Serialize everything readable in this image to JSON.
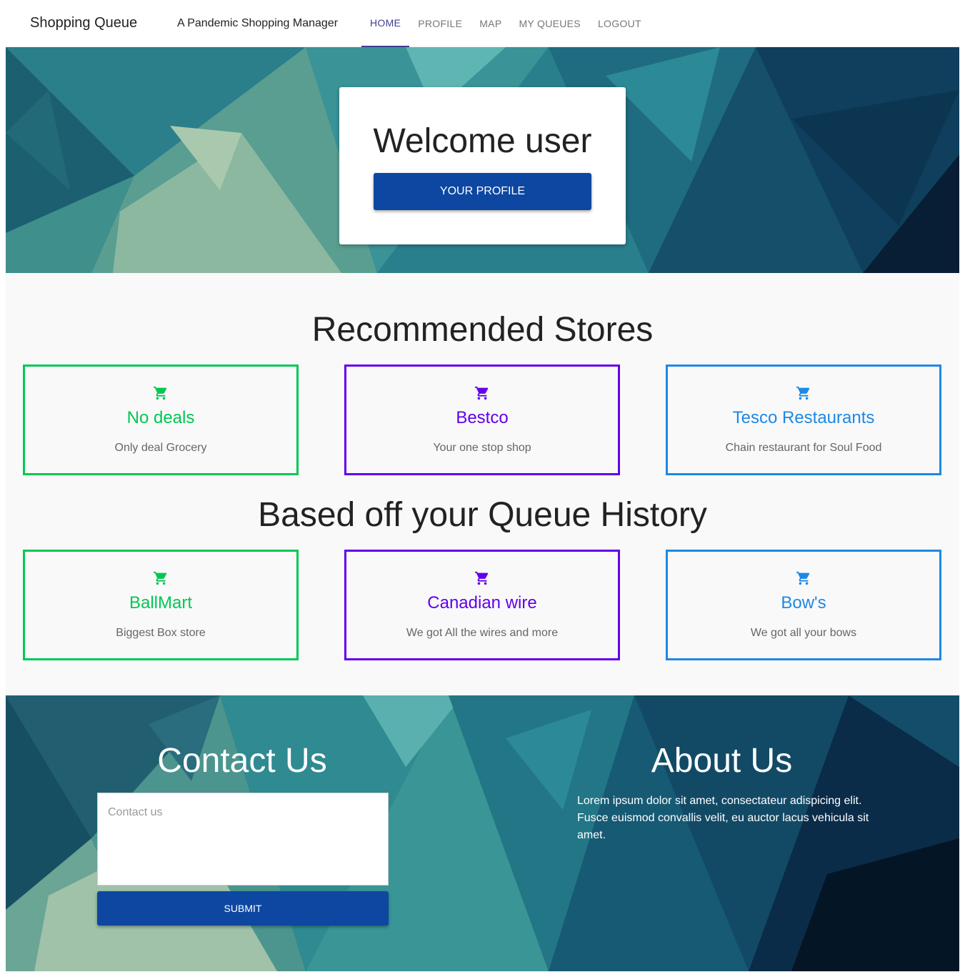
{
  "header": {
    "brand": "Shopping Queue",
    "tagline": "A Pandemic Shopping Manager",
    "nav": [
      {
        "label": "HOME",
        "active": true
      },
      {
        "label": "PROFILE",
        "active": false
      },
      {
        "label": "MAP",
        "active": false
      },
      {
        "label": "MY QUEUES",
        "active": false
      },
      {
        "label": "LOGOUT",
        "active": false
      }
    ]
  },
  "hero": {
    "welcome": "Welcome user",
    "profile_button": "YOUR PROFILE"
  },
  "recommended": {
    "title": "Recommended Stores",
    "stores": [
      {
        "name": "No deals",
        "desc": "Only deal Grocery",
        "color": "#00c853"
      },
      {
        "name": "Bestco",
        "desc": "Your one stop shop",
        "color": "#6200ea"
      },
      {
        "name": "Tesco Restaurants",
        "desc": "Chain restaurant for Soul Food",
        "color": "#1e88e5"
      }
    ]
  },
  "history": {
    "title": "Based off your Queue History",
    "stores": [
      {
        "name": "BallMart",
        "desc": "Biggest Box store",
        "color": "#00c853"
      },
      {
        "name": "Canadian wire",
        "desc": "We got All the wires and more",
        "color": "#6200ea"
      },
      {
        "name": "Bow's",
        "desc": "We got all your bows",
        "color": "#1e88e5"
      }
    ]
  },
  "contact": {
    "title": "Contact Us",
    "placeholder": "Contact us",
    "submit": "SUBMIT"
  },
  "about": {
    "title": "About Us",
    "text": "Lorem ipsum dolor sit amet, consectateur adispicing elit. Fusce euismod convallis velit, eu auctor lacus vehicula sit amet."
  },
  "icons": {
    "store": "shopping-cart-icon"
  },
  "colors": {
    "primary_button": "#0d47a1",
    "nav_active": "#3f3f8f"
  }
}
